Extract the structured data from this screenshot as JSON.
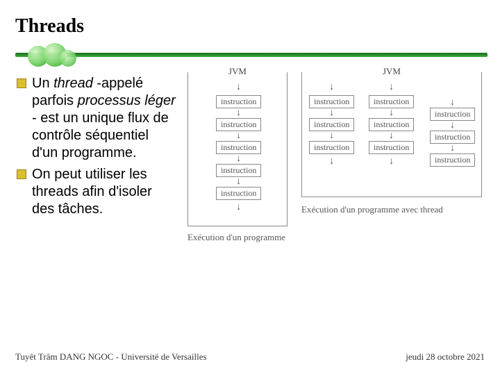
{
  "title": "Threads",
  "bullets": [
    {
      "pre": "Un ",
      "it1": "thread",
      "mid1": " -appelé parfois ",
      "it2": "processus léger",
      "mid2": " - est un unique flux de contrôle séquentiel d'un programme."
    },
    {
      "pre": "On peut utiliser les threads afin d'isoler des tâches.",
      "it1": "",
      "mid1": "",
      "it2": "",
      "mid2": ""
    }
  ],
  "jvm_label": "JVM",
  "instruction_label": "instruction",
  "caption1": "Exécution d'un programme",
  "caption2": "Exécution d'un programme avec thread",
  "footer_left": "Tuyêt Trâm DANG NGOC - Université de Versailles",
  "footer_right": "jeudi 28 octobre 2021"
}
